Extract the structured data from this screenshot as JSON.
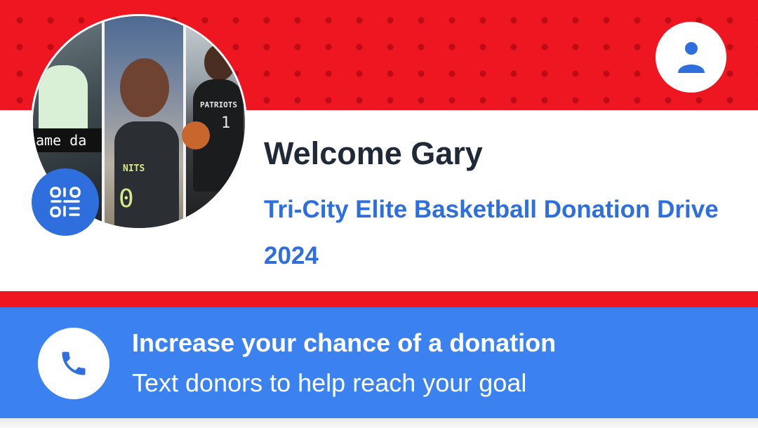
{
  "header": {
    "welcome_text": "Welcome Gary",
    "campaign_title": "Tri-City Elite Basketball Donation Drive 2024",
    "account_icon": "person-icon",
    "qr_icon": "qr-code-icon",
    "photo_caption": "ame da",
    "photo_jersey_texts": [
      "NITS",
      "0",
      "PATRIOTS",
      "1"
    ]
  },
  "cta": {
    "title": "Increase your chance of a donation",
    "subtitle": "Text donors to help reach your goal",
    "icon": "phone-icon"
  },
  "colors": {
    "banner_red": "#ee1620",
    "accent_blue": "#2f6fdd",
    "cta_blue": "#3b82f0",
    "heading_dark": "#1f2937"
  }
}
